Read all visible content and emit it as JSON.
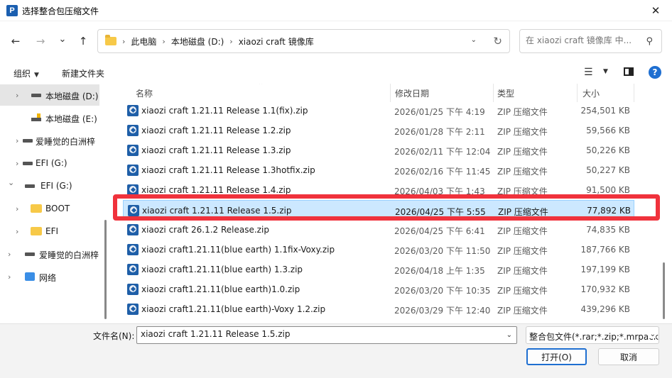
{
  "window": {
    "app_icon_letter": "P",
    "title": "选择整合包压缩文件",
    "close_glyph": "✕"
  },
  "nav": {
    "back_glyph": "←",
    "forward_glyph": "→",
    "recent_glyph": "⌄",
    "up_glyph": "↑",
    "breadcrumbs": [
      "此电脑",
      "本地磁盘 (D:)",
      "xiaozi craft 镜像库"
    ],
    "breadcrumb_sep": "›",
    "dropdown_glyph": "⌄",
    "refresh_glyph": "↻",
    "search_placeholder": "在 xiaozi craft 镜像库 中...",
    "search_glyph": "⚲"
  },
  "toolbar": {
    "organize": "组织",
    "new_folder": "新建文件夹",
    "caret": "▼",
    "view_glyph": "☰",
    "help_glyph": "?"
  },
  "navpane": {
    "items": [
      {
        "label": "本地磁盘 (D:)",
        "icon": "drive-icon",
        "chevron": "›",
        "selected": true
      },
      {
        "label": "本地磁盘 (E:)",
        "icon": "usb-drive-icon",
        "chevron": "",
        "selected": false
      },
      {
        "label": "爱睡觉的白洲梓",
        "icon": "drive-icon",
        "chevron": "›",
        "selected": false
      },
      {
        "label": "EFI (G:)",
        "icon": "drive-icon",
        "chevron": "›",
        "selected": false
      },
      {
        "label": "EFI (G:)",
        "icon": "drive-icon",
        "chevron": "⌄",
        "selected": false
      },
      {
        "label": "BOOT",
        "icon": "folder-icon",
        "chevron": "›",
        "selected": false
      },
      {
        "label": "EFI",
        "icon": "folder-icon",
        "chevron": "›",
        "selected": false
      },
      {
        "label": "爱睡觉的白洲梓",
        "icon": "drive-icon",
        "chevron": "›",
        "selected": false
      },
      {
        "label": "网络",
        "icon": "network-icon",
        "chevron": "›",
        "selected": false
      }
    ]
  },
  "filelist": {
    "columns": {
      "name": "名称",
      "date": "修改日期",
      "type": "类型",
      "size": "大小"
    },
    "sort_glyph": "⌃",
    "rows": [
      {
        "name": "xiaozi craft 1.21.11 Release 1.1(fix).zip",
        "date": "2026/01/25 下午 4:19",
        "type": "ZIP 压缩文件",
        "size": "254,501 KB"
      },
      {
        "name": "xiaozi craft 1.21.11 Release 1.2.zip",
        "date": "2026/01/28 下午 2:11",
        "type": "ZIP 压缩文件",
        "size": "59,566 KB"
      },
      {
        "name": "xiaozi craft 1.21.11 Release 1.3.zip",
        "date": "2026/02/11 下午 12:04",
        "type": "ZIP 压缩文件",
        "size": "50,226 KB"
      },
      {
        "name": "xiaozi craft 1.21.11 Release 1.3hotfix.zip",
        "date": "2026/02/16 下午 11:45",
        "type": "ZIP 压缩文件",
        "size": "50,227 KB"
      },
      {
        "name": "xiaozi craft 1.21.11 Release 1.4.zip",
        "date": "2026/04/03 下午 1:43",
        "type": "ZIP 压缩文件",
        "size": "91,500 KB"
      },
      {
        "name": "xiaozi craft 1.21.11 Release 1.5.zip",
        "date": "2026/04/25 下午 5:55",
        "type": "ZIP 压缩文件",
        "size": "77,892 KB",
        "selected": true
      },
      {
        "name": "xiaozi craft 26.1.2 Release.zip",
        "date": "2026/04/25 下午 6:41",
        "type": "ZIP 压缩文件",
        "size": "74,835 KB"
      },
      {
        "name": "xiaozi craft1.21.11(blue earth) 1.1fix-Voxy.zip",
        "date": "2026/03/20 下午 11:50",
        "type": "ZIP 压缩文件",
        "size": "187,766 KB"
      },
      {
        "name": "xiaozi craft1.21.11(blue earth) 1.3.zip",
        "date": "2026/04/18 上午 1:35",
        "type": "ZIP 压缩文件",
        "size": "197,199 KB"
      },
      {
        "name": "xiaozi craft1.21.11(blue earth)1.0.zip",
        "date": "2026/03/20 下午 10:35",
        "type": "ZIP 压缩文件",
        "size": "170,932 KB"
      },
      {
        "name": "xiaozi craft1.21.11(blue earth)-Voxy 1.2.zip",
        "date": "2026/03/29 下午 12:40",
        "type": "ZIP 压缩文件",
        "size": "439,296 KB"
      }
    ]
  },
  "bottom": {
    "filename_label": "文件名(N):",
    "filename_value": "xiaozi craft 1.21.11 Release 1.5.zip",
    "filter_value": "整合包文件(*.rar;*.zip;*.mrpack)",
    "open_label": "打开(O)",
    "cancel_label": "取消",
    "caret": "⌄"
  },
  "colors": {
    "accent": "#1f6fd1",
    "selection": "#cce8ff",
    "highlight": "#f0323c"
  }
}
